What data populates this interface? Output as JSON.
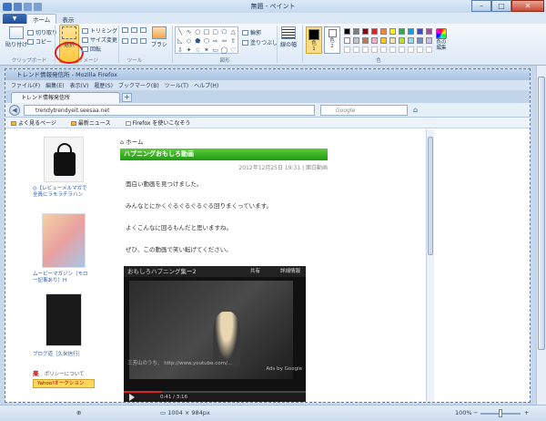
{
  "paint": {
    "title": "無題 - ペイント",
    "tabs": [
      "ホーム",
      "表示"
    ],
    "clipboard": {
      "paste": "貼り付け",
      "cut": "切り取り",
      "copy": "コピー",
      "label": "クリップボード"
    },
    "image": {
      "select": "選択",
      "crop": "トリミング",
      "resize": "サイズ変更",
      "rotate": "回転",
      "label": "イメージ"
    },
    "tools": {
      "label": "ツール"
    },
    "brushes": "ブラシ",
    "shapes": {
      "outline": "輪郭",
      "fill": "塗りつぶし",
      "label": "図形"
    },
    "size": "線の幅",
    "color1": "色\n1",
    "color2": "色\n2",
    "edit_colors": "色の\n編集",
    "colors_label": "色",
    "accent": "#ffc73d"
  },
  "browser": {
    "title": "トレンド情報発信所 - Mozilla Firefox",
    "menu": [
      "ファイル(F)",
      "編集(E)",
      "表示(V)",
      "履歴(S)",
      "ブックマーク(B)",
      "ツール(T)",
      "ヘルプ(H)"
    ],
    "tab": "トレンド情報発信所",
    "url": "trendytrendyeit.seesaa.net",
    "search_placeholder": "Google",
    "bookmarks": [
      "よく見るページ",
      "最新ニュース",
      "Firefox を使いこなそう"
    ]
  },
  "webpage": {
    "home": "ホーム",
    "post_title": "ハプニングおもしろ動画",
    "post_date": "2012年12月25日 19:31 | 面白動画",
    "lines": [
      "面白い動画を見つけました。",
      "みんなとにかくぐるぐるぐるぐる回りまくっています。",
      "よくこんなに回るもんだと思いますね。",
      "ぜひ、この動画で笑い転げてください。"
    ],
    "side_items": [
      "◎【レビューメルマガで全員にラモラチラハン",
      "ムービーマガジン（モロー記事あり）H",
      "ブログ道［久米信行］"
    ],
    "rakuten": "楽",
    "rakuten_link": "ポリシーについて",
    "yahoo": "Yahoo!オークション",
    "video_title": "おもしろハプニング集ー2",
    "video_share": "共有",
    "video_info": "詳細情報",
    "video_overlay": "三芳山のうち、 http://www.youtube.com/...",
    "video_ads": "Ads by Google",
    "video_time": "0:41 / 3:16"
  },
  "statusbar": {
    "size": "1004 × 984px",
    "zoom": "100%"
  },
  "palette": [
    "#000000",
    "#7f7f7f",
    "#880015",
    "#ed1c24",
    "#ff7f27",
    "#fff200",
    "#22b14c",
    "#00a2e8",
    "#3f48cc",
    "#a349a4",
    "#ffffff",
    "#c3c3c3",
    "#b97a57",
    "#ffaec9",
    "#ffc90e",
    "#efe4b0",
    "#b5e61d",
    "#99d9ea",
    "#7092be",
    "#c8bfe7"
  ]
}
